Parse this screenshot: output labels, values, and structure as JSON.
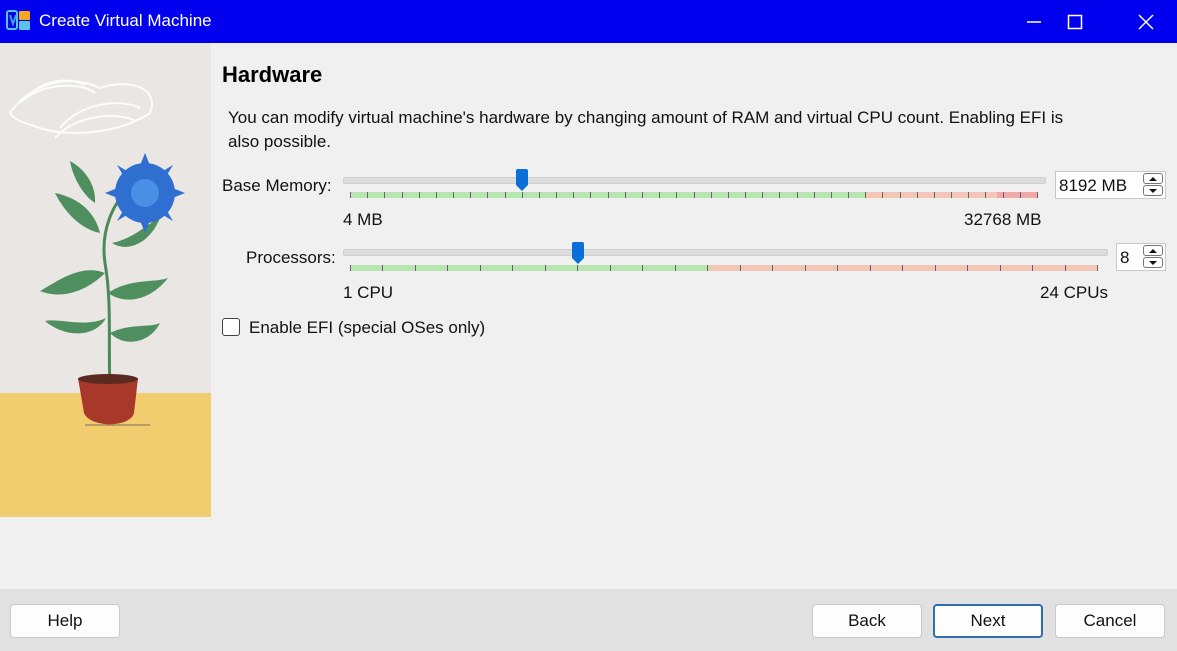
{
  "window": {
    "title": "Create Virtual Machine",
    "controls": {
      "minimize_icon": "minimize-icon",
      "maximize_icon": "maximize-icon",
      "close_icon": "close-icon"
    }
  },
  "page": {
    "heading": "Hardware",
    "description": "You can modify virtual machine's hardware by changing amount of RAM and virtual CPU count. Enabling EFI is also possible."
  },
  "memory": {
    "label": "Base Memory:",
    "min_label": "4 MB",
    "max_label": "32768 MB",
    "min": 4,
    "max": 32768,
    "value": 8192,
    "value_text": "8192 MB"
  },
  "processors": {
    "label": "Processors:",
    "min_label": "1 CPU",
    "max_label": "24 CPUs",
    "min": 1,
    "max": 24,
    "value": 8,
    "value_text": "8"
  },
  "efi": {
    "label": "Enable EFI (special OSes only)",
    "checked": false
  },
  "buttons": {
    "help": "Help",
    "back": "Back",
    "next": "Next",
    "cancel": "Cancel"
  },
  "colors": {
    "titlebar": "#0000ee",
    "slider_handle": "#0a6fd6",
    "scale_ok": "#b8e6b0",
    "scale_warn": "#f3c6b6",
    "scale_bad": "#f0a8a8"
  }
}
